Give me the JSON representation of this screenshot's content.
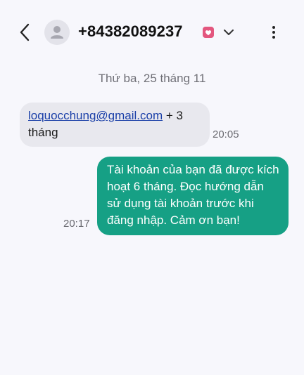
{
  "header": {
    "phone_number": "+84382089237",
    "back_icon": "chevron-left-icon",
    "avatar_icon": "person-icon",
    "sim_icon": "sim-badge-icon",
    "dropdown_icon": "chevron-down-icon",
    "menu_icon": "more-vertical-icon"
  },
  "conversation": {
    "date_separator": "Thứ ba, 25 tháng 11",
    "messages": [
      {
        "direction": "incoming",
        "link_text": "loquocchung@gmail.com",
        "text_after_link": " + 3 tháng",
        "time": "20:05"
      },
      {
        "direction": "outgoing",
        "text": "Tài khoản của bạn đã được kích hoạt 6 tháng. Đọc hướng dẫn sử dụng tài khoản trước khi đăng nhập. Cảm ơn bạn!",
        "time": "20:17"
      }
    ]
  },
  "colors": {
    "background": "#f7f7fc",
    "incoming_bubble": "#e8e8ee",
    "outgoing_bubble": "#16a085",
    "link": "#1a3fa8",
    "sim_badge": "#e3567e"
  }
}
